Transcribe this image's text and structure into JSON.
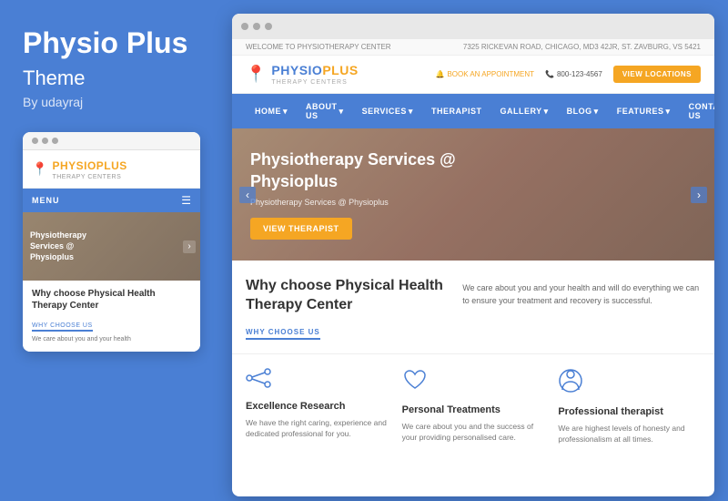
{
  "left": {
    "title": "Physio Plus",
    "subtitle": "Theme",
    "author": "By udayraj"
  },
  "mobile": {
    "logo": "PHYSIOPLUS",
    "logo_sub": "THERAPY CENTERS",
    "menu_label": "MENU",
    "hero_text_line1": "Physiotherapy",
    "hero_text_line2": "Services @",
    "hero_text_line3": "Physioplus",
    "why_title": "Why choose Physical Health Therapy Center",
    "why_label": "WHY CHOOSE US",
    "why_text": "We care about you and your health"
  },
  "browser": {
    "top_welcome": "WELCOME TO PHYSIOTHERAPY CENTER",
    "top_address": "7325 RICKEVAN ROAD, CHICAGO, MD3 42JR, ST. ZAVBURG, VS 5421",
    "logo_name": "PHYSIO",
    "logo_name2": "PLUS",
    "logo_sub": "THERAPY CENTERS",
    "appt_label": "BOOK AN APPOINTMENT",
    "phone": "800-123-4567",
    "btn_locations": "VIEW LOCATIONS",
    "nav": [
      {
        "label": "HOME"
      },
      {
        "label": "ABOUT US"
      },
      {
        "label": "SERVICES"
      },
      {
        "label": "THERAPIST"
      },
      {
        "label": "GALLERY"
      },
      {
        "label": "BLOG"
      },
      {
        "label": "FEATURES"
      },
      {
        "label": "CONTACT US"
      }
    ],
    "hero_title": "Physiotherapy Services @ Physioplus",
    "hero_subtitle": "Physiotherapy Services @ Physioplus",
    "hero_btn": "VIEW THERAPIST",
    "why_title": "Why choose Physical Health Therapy Center",
    "why_label": "WHY CHOOSE US",
    "why_text": "We care about you and your health and will do everything we can to ensure your treatment and recovery is successful.",
    "features": [
      {
        "icon": "share",
        "title": "Excellence Research",
        "text": "We have the right caring, experience and dedicated professional for you."
      },
      {
        "icon": "heart",
        "title": "Personal Treatments",
        "text": "We care about you and the success of your providing personalised care."
      },
      {
        "icon": "person",
        "title": "Professional therapist",
        "text": "We are highest levels of honesty and professionalism at all times."
      }
    ]
  }
}
